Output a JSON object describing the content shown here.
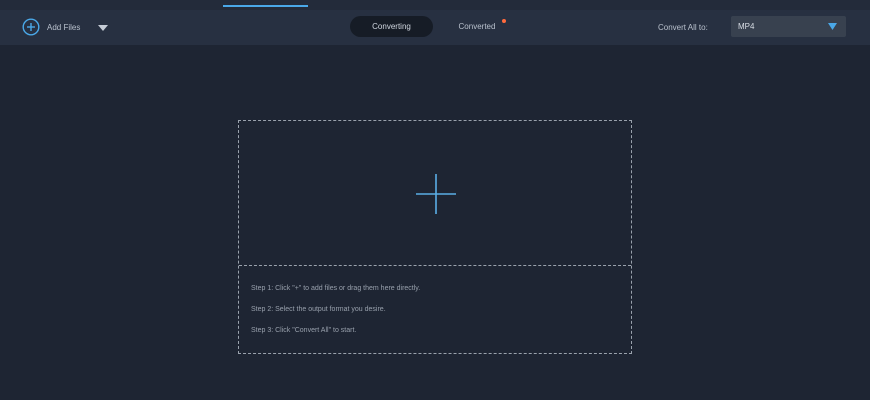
{
  "toolbar": {
    "add_files_label": "Add Files",
    "tabs": [
      {
        "label": "Converting",
        "active": true
      },
      {
        "label": "Converted",
        "active": false,
        "has_notification": true
      }
    ],
    "convert_all_label": "Convert All to:",
    "format": {
      "selected": "MP4"
    }
  },
  "drop_zone": {
    "steps": [
      "Step 1: Click \"+\" to add files or drag them here directly.",
      "Step 2: Select the output format you desire.",
      "Step 3: Click \"Convert All\" to start."
    ]
  },
  "colors": {
    "background": "#1e2533",
    "toolbar": "#273041",
    "accent": "#4aa8e8",
    "notification": "#ff6a3d"
  },
  "icons": [
    "add-circle-icon",
    "chevron-down-icon",
    "plus-icon",
    "triangle-down-icon"
  ]
}
